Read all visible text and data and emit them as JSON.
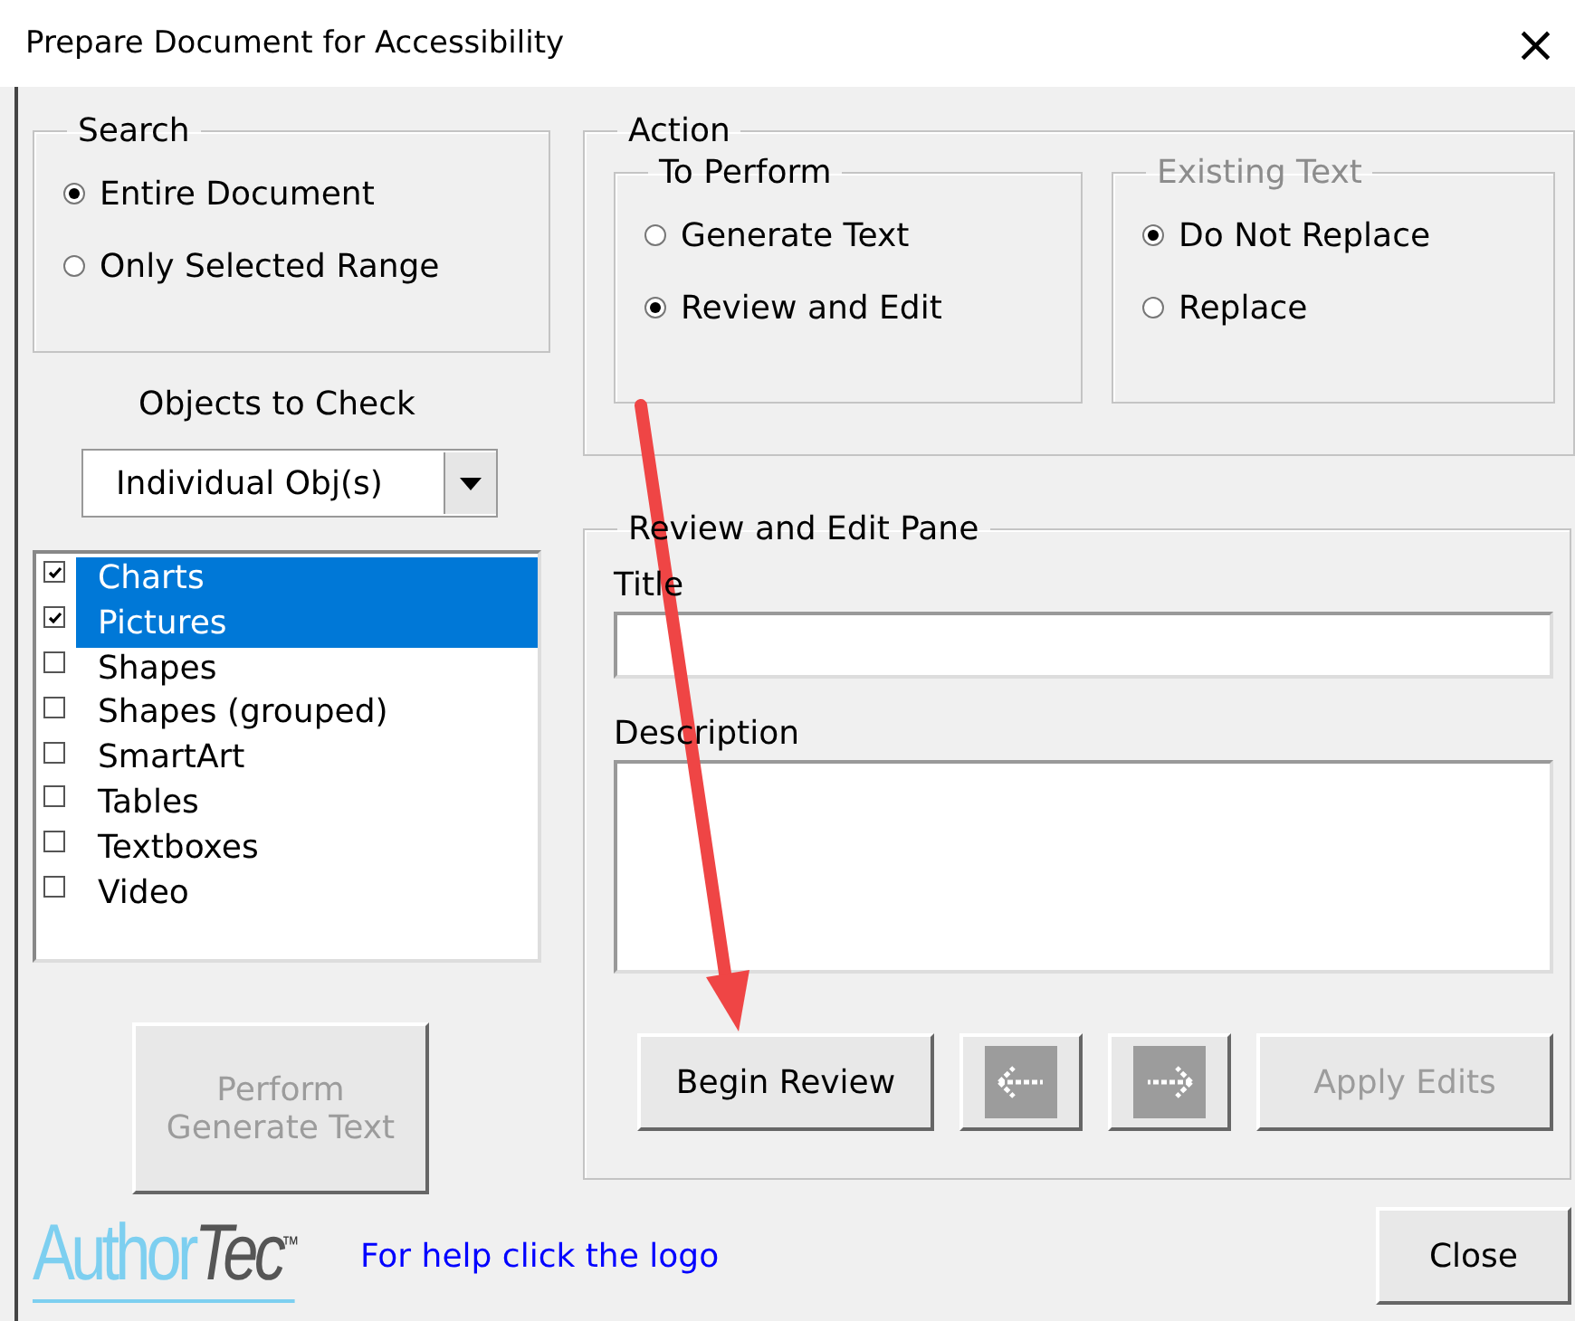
{
  "window": {
    "title": "Prepare Document for Accessibility",
    "close": "×"
  },
  "search": {
    "legend": "Search",
    "options": [
      {
        "label": "Entire Document",
        "selected": true
      },
      {
        "label": "Only Selected Range",
        "selected": false
      }
    ]
  },
  "objects": {
    "label": "Objects to Check",
    "dropdown": {
      "value": "Individual Obj(s)"
    },
    "items": [
      {
        "label": "Charts",
        "checked": true,
        "selected": true
      },
      {
        "label": "Pictures",
        "checked": true,
        "selected": true
      },
      {
        "label": "Shapes",
        "checked": false,
        "selected": false
      },
      {
        "label": "Shapes (grouped)",
        "checked": false,
        "selected": false
      },
      {
        "label": "SmartArt",
        "checked": false,
        "selected": false
      },
      {
        "label": "Tables",
        "checked": false,
        "selected": false
      },
      {
        "label": "Textboxes",
        "checked": false,
        "selected": false
      },
      {
        "label": "Video",
        "checked": false,
        "selected": false
      }
    ]
  },
  "perform_button": {
    "lines": [
      "Perform",
      "Generate Text"
    ],
    "disabled": true
  },
  "logo": {
    "text_1": "Author",
    "text_2": "Tec",
    "mark": "™"
  },
  "help_link": "For help click the logo",
  "action": {
    "legend": "Action",
    "to_perform": {
      "legend": "To Perform",
      "disabled": false,
      "options": [
        {
          "label": "Generate Text",
          "selected": false
        },
        {
          "label": "Review and Edit",
          "selected": true
        }
      ]
    },
    "existing_text": {
      "legend": "Existing Text",
      "disabled": true,
      "options": [
        {
          "label": "Do Not Replace",
          "selected": true
        },
        {
          "label": "Replace",
          "selected": false
        }
      ]
    }
  },
  "review_pane": {
    "legend": "Review and Edit Pane",
    "title_label": "Title",
    "description_label": "Description",
    "buttons": [
      {
        "kind": "text",
        "label": "Begin Review",
        "disabled": false
      },
      {
        "kind": "previous",
        "disabled": true
      },
      {
        "kind": "next",
        "disabled": true
      },
      {
        "kind": "text",
        "label": "Apply Edits",
        "disabled": true
      }
    ]
  },
  "close_button": "Close"
}
